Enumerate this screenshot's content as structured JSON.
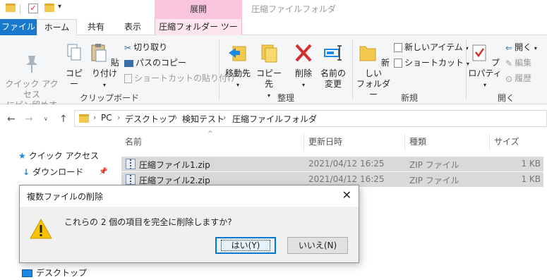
{
  "titlebar": {
    "context_group": "展開",
    "window_title": "圧縮ファイルフォルダ"
  },
  "tabs": [
    "ファイル",
    "ホーム",
    "共有",
    "表示",
    "圧縮フォルダー ツール"
  ],
  "ribbon": {
    "clipboard": {
      "pin_quick_access": "クイック アクセス\nにピン留めする",
      "copy": "コピー",
      "paste": "貼り付け",
      "cut": "切り取り",
      "copy_path": "パスのコピー",
      "paste_shortcut": "ショートカットの貼り付け",
      "label": "クリップボード"
    },
    "organize": {
      "move_to": "移動先",
      "copy_to": "コピー先",
      "delete": "削除",
      "rename_1": "名前の",
      "rename_2": "変更",
      "label": "整理"
    },
    "new": {
      "new_folder_1": "新しい",
      "new_folder_2": "フォルダー",
      "new_item": "新しいアイテム",
      "shortcut": "ショートカット",
      "label": "新規"
    },
    "open": {
      "properties": "プロパティ",
      "open": "開く",
      "edit": "編集",
      "history": "履歴",
      "label": "開く"
    }
  },
  "address": {
    "crumbs": [
      "PC",
      "デスクトップ",
      "検知テスト",
      "圧縮ファイルフォルダ"
    ]
  },
  "navpane": {
    "quick_access": "クイック アクセス",
    "downloads": "ダウンロード",
    "desktop": "デスクトップ"
  },
  "columns": [
    "名前",
    "更新日時",
    "種類",
    "サイズ"
  ],
  "files": [
    {
      "name": "圧縮ファイル1.zip",
      "date": "2021/04/12 16:25",
      "type": "ZIP ファイル",
      "size": "1 KB"
    },
    {
      "name": "圧縮ファイル2.zip",
      "date": "2021/04/12 16:25",
      "type": "ZIP ファイル",
      "size": "1 KB"
    }
  ],
  "dialog": {
    "title": "複数ファイルの削除",
    "close": "✕",
    "message": "これらの 2 個の項目を完全に削除しますか?",
    "yes": "はい(Y)",
    "no": "いいえ(N)"
  },
  "colors": {
    "file_tab": "#1979ca",
    "context_tab": "#f9c6dd",
    "selection": "#d9d9d9",
    "dialog_default_button": "#0078d7"
  }
}
